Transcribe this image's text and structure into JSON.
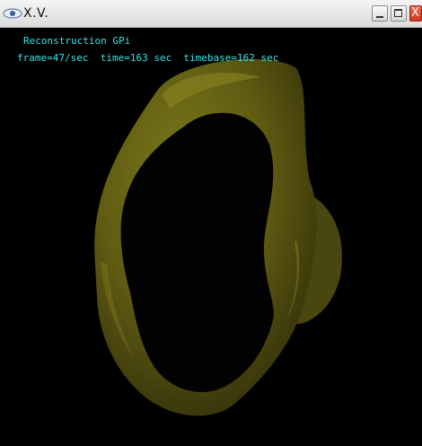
{
  "window": {
    "title": "X.V.",
    "minimize_label": "_",
    "maximize_label": "□",
    "close_label": "X"
  },
  "overlay": {
    "title": "Reconstruction GPi",
    "stats": "frame=47/sec  time=163 sec  timebase=162 sec"
  },
  "colors": {
    "background": "#000000",
    "overlay_text": "#33e6e6",
    "surface": "#5e5a13"
  },
  "icons": {
    "app": "eye-icon",
    "minimize": "minimize-icon",
    "maximize": "maximize-icon",
    "close": "close-icon"
  }
}
